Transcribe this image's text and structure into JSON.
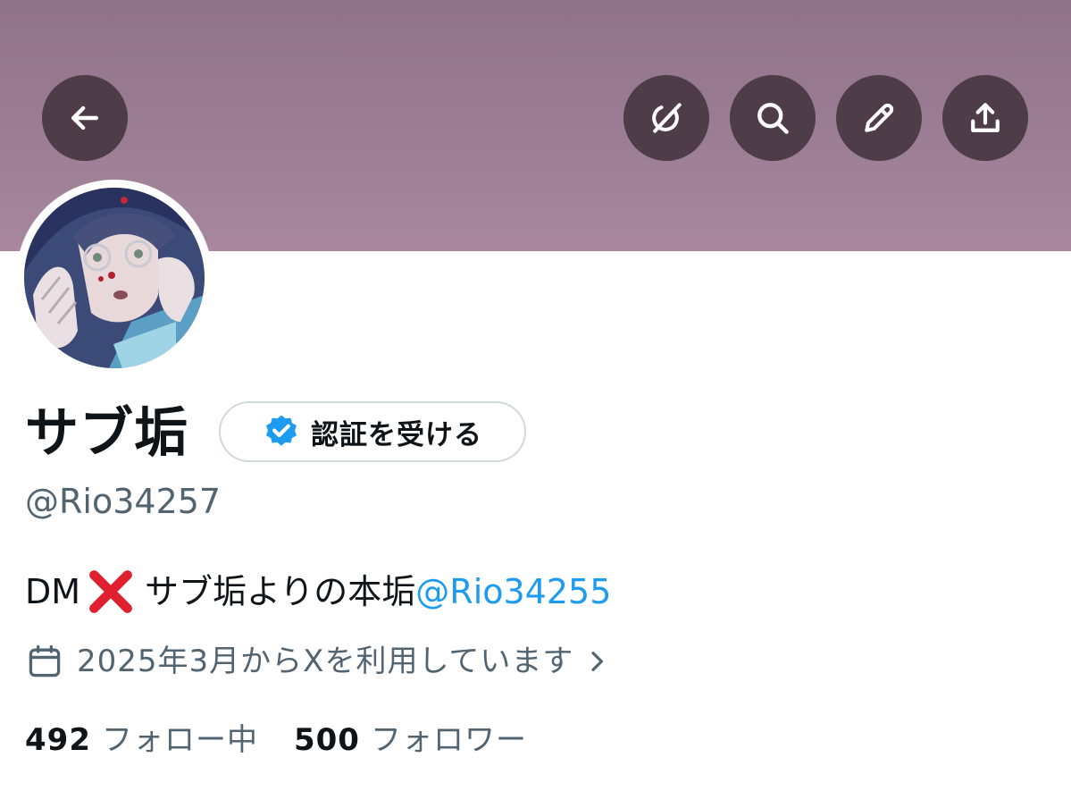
{
  "colors": {
    "banner": "#9c7e94",
    "header_button": "#4e3c48",
    "text_primary": "#0f1419",
    "text_secondary": "#536471",
    "link": "#1d9bf0",
    "verified_badge": "#1d9bf0"
  },
  "header": {
    "buttons": [
      {
        "name": "back",
        "icon": "arrow-left-icon"
      },
      {
        "name": "grok",
        "icon": "grok-icon"
      },
      {
        "name": "search",
        "icon": "search-icon"
      },
      {
        "name": "edit",
        "icon": "pencil-icon"
      },
      {
        "name": "share",
        "icon": "share-icon"
      }
    ]
  },
  "profile": {
    "display_name": "サブ垢",
    "verify_button_label": "認証を受ける",
    "handle": "@Rio34257",
    "bio": {
      "prefix": "DM",
      "emoji": "cross-mark-icon",
      "text": "サブ垢よりの本垢",
      "mention": "@Rio34255"
    },
    "joined": "2025年3月からXを利用しています",
    "following": {
      "count": "492",
      "label": "フォロー中"
    },
    "followers": {
      "count": "500",
      "label": "フォロワー"
    }
  }
}
